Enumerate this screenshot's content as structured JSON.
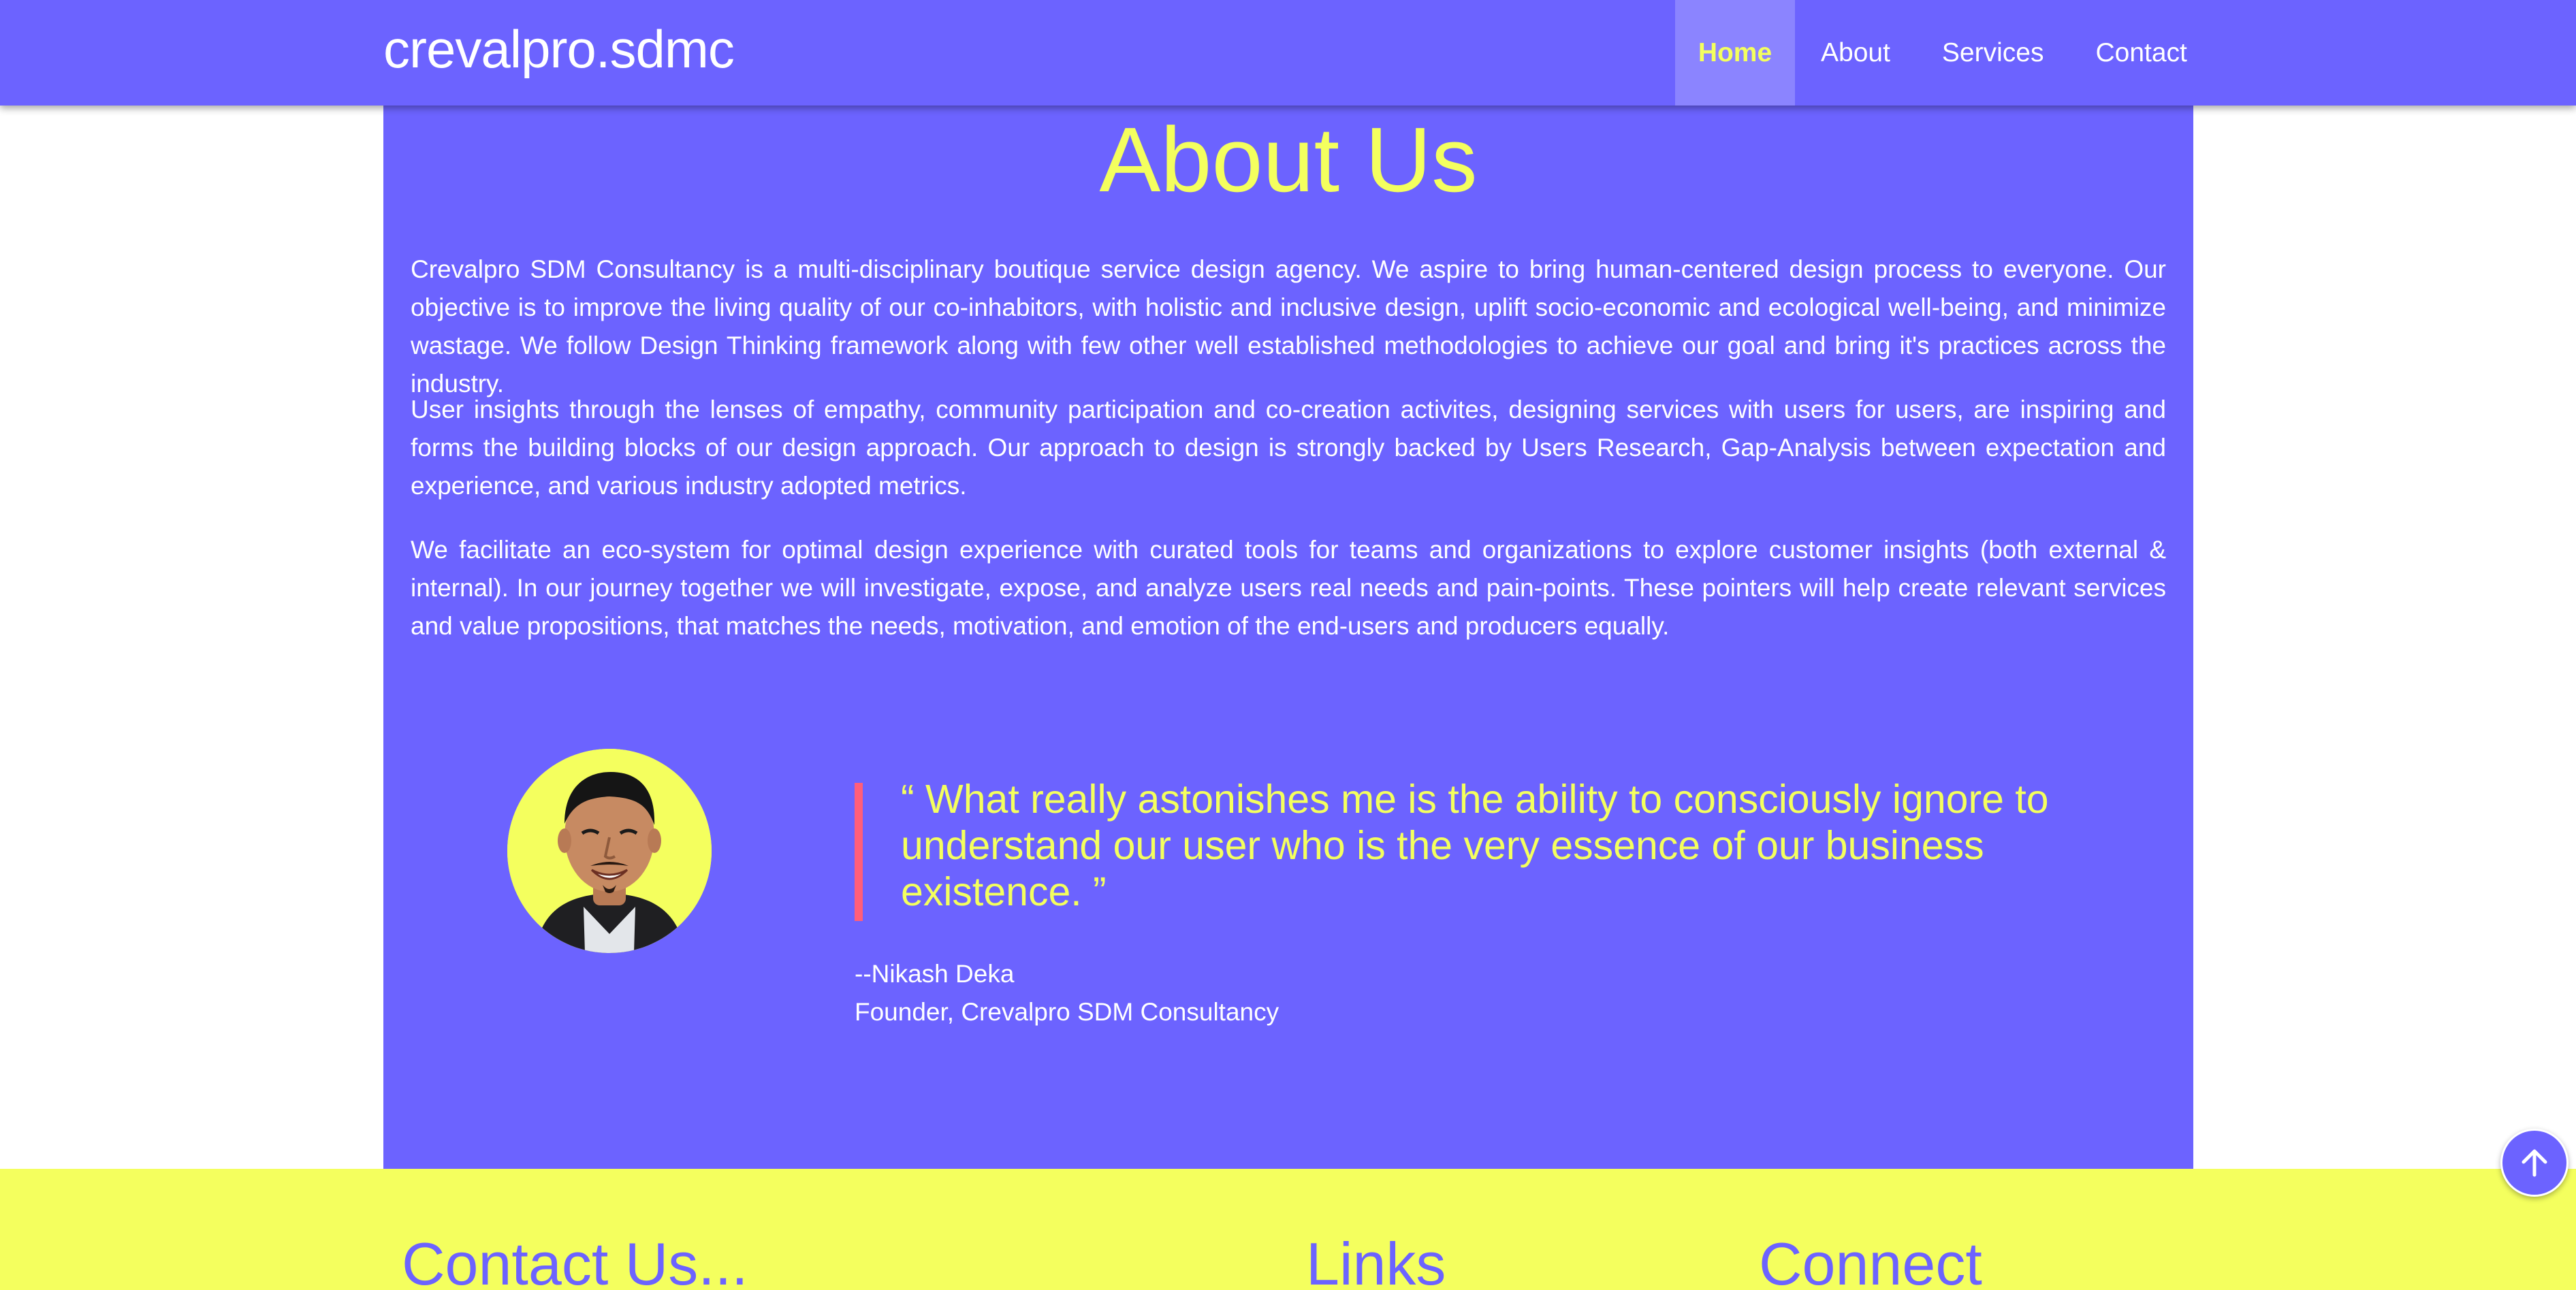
{
  "header": {
    "brand": "crevalpro.sdmc",
    "nav": [
      {
        "label": "Home",
        "active": true
      },
      {
        "label": "About",
        "active": false
      },
      {
        "label": "Services",
        "active": false
      },
      {
        "label": "Contact",
        "active": false
      }
    ]
  },
  "about": {
    "title": "About Us",
    "paragraphs": [
      "Crevalpro SDM Consultancy is a multi-disciplinary boutique service design agency. We aspire to bring human-centered design process to everyone. Our objective is to improve the living quality of our co-inhabitors, with holistic and inclusive design, uplift socio-economic and ecological well-being, and minimize wastage. We follow Design Thinking framework along with few other well established methodologies to achieve our goal and bring it's practices across the industry.",
      "User insights through the lenses of empathy, community participation and co-creation activites, designing services with users for users, are inspiring and forms the building blocks of our design approach. Our approach to design is strongly backed by Users Research, Gap-Analysis between expectation and experience, and various industry adopted metrics.",
      "We facilitate an eco-system for optimal design experience with curated tools for teams and organizations to explore customer insights (both external & internal). In our journey together we will investigate, expose, and analyze users real needs and pain-points. These pointers will help create relevant services and value propositions, that matches the needs, motivation, and emotion of the end-users and producers equally."
    ],
    "quote": "“ What really astonishes me is the ability to consciously ignore to understand our user who is the very essence of our business existence. ”",
    "author": "--Nikash Deka",
    "author_role": "Founder, Crevalpro SDM Consultancy"
  },
  "footer": {
    "contact_heading": "Contact Us...",
    "links_heading": "Links",
    "connect_heading": "Connect"
  },
  "colors": {
    "primary": "#6c63ff",
    "accent": "#f4ff5e",
    "quote_bar": "#ff5e7a"
  },
  "icons": {
    "scroll_top": "arrow-up-icon"
  }
}
